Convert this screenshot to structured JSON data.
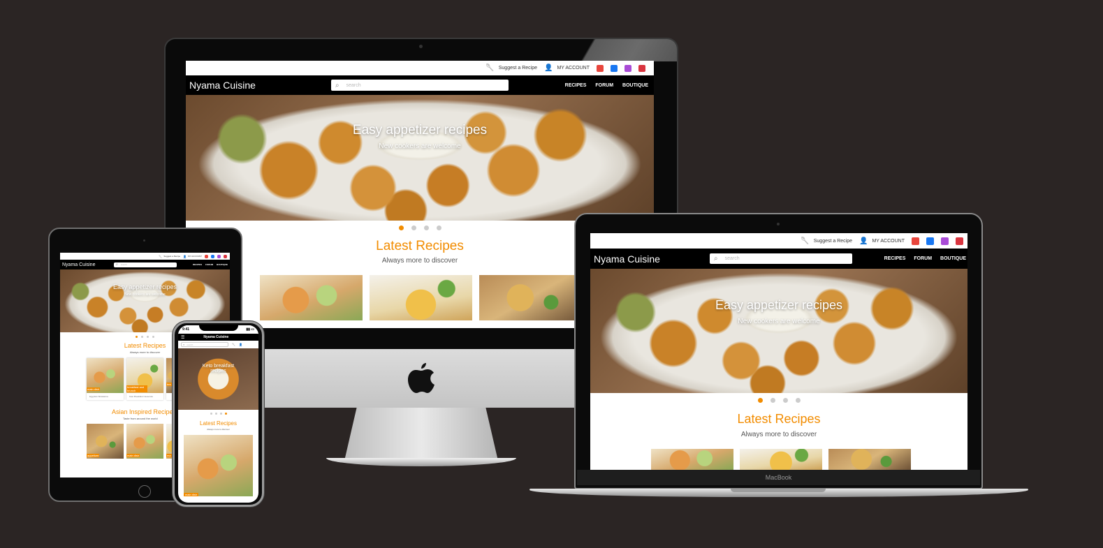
{
  "site": {
    "brand": "Nyama Cuisine",
    "suggest": "Suggest a Recipe",
    "account": "MY ACCOUNT",
    "search_placeholder": "search",
    "nav": [
      "RECIPES",
      "FORUM",
      "BOUTIQUE"
    ],
    "hero_title": "Easy appetizer recipes",
    "hero_sub": "New cookers are welcome",
    "latest_title": "Latest Recipes",
    "latest_sub": "Always more to discover",
    "asian_title": "Asian Inspired Recipe",
    "asian_sub": "Taste from around the world",
    "social_icons": [
      "youtube-icon",
      "facebook-icon",
      "instagram-icon",
      "pinterest-icon"
    ]
  },
  "ipad": {
    "cards": [
      "main dish",
      "breakfast and brunch",
      "bre"
    ],
    "card_titles": [
      "Egyptian Shawarma",
      "Keto Breakfast Casserole",
      ""
    ],
    "asian_tags": [
      "appetizer",
      "main dish",
      "ma"
    ]
  },
  "iphone": {
    "time": "9:41",
    "hero_title": "Keto breakfast recipes",
    "tag": "main dish"
  },
  "macbook": {
    "label": "MacBook"
  },
  "colors": {
    "accent": "#f28c00",
    "background": "#2b2524",
    "nav": "#000000"
  }
}
